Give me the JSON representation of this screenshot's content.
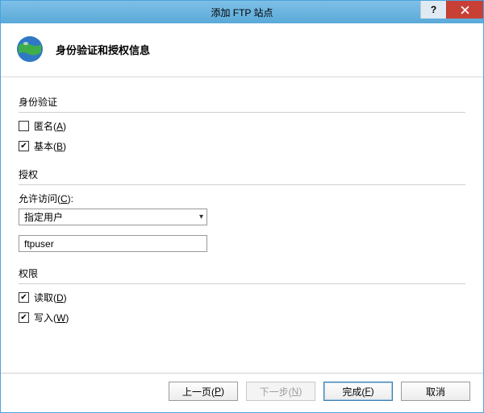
{
  "titlebar": {
    "title": "添加 FTP 站点",
    "help": "?",
    "close": "×"
  },
  "header": {
    "title": "身份验证和授权信息"
  },
  "auth": {
    "section": "身份验证",
    "anonymous": {
      "label_pre": "匿名(",
      "key": "A",
      "label_post": ")",
      "checked": false
    },
    "basic": {
      "label_pre": "基本(",
      "key": "B",
      "label_post": ")",
      "checked": true
    }
  },
  "authorization": {
    "section": "授权",
    "allow_label_pre": "允许访问(",
    "allow_key": "C",
    "allow_label_post": "):",
    "allow_selected": "指定用户",
    "user_value": "ftpuser"
  },
  "perm": {
    "section": "权限",
    "read": {
      "label_pre": "读取(",
      "key": "D",
      "label_post": ")",
      "checked": true
    },
    "write": {
      "label_pre": "写入(",
      "key": "W",
      "label_post": ")",
      "checked": true
    }
  },
  "buttons": {
    "prev": {
      "pre": "上一页(",
      "key": "P",
      "post": ")"
    },
    "next": {
      "pre": "下一步(",
      "key": "N",
      "post": ")"
    },
    "finish": {
      "pre": "完成(",
      "key": "F",
      "post": ")"
    },
    "cancel": "取消"
  }
}
